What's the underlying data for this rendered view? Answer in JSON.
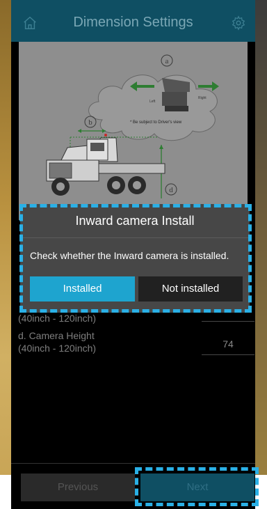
{
  "header": {
    "title": "Dimension Settings"
  },
  "diagram": {
    "marker_a": "a",
    "marker_b": "b",
    "marker_d": "d",
    "left_label": "Left",
    "right_label": "Right",
    "note": "* Be subject to Driver's view"
  },
  "fields": [
    {
      "label_line1": "(40inch - 120inch)",
      "value": ""
    },
    {
      "label_line1": "d. Camera Height",
      "label_line2": "(40inch - 120inch)",
      "value": "74"
    }
  ],
  "dialog": {
    "title": "Inward camera Install",
    "message": "Check whether the Inward camera is installed.",
    "installed_label": "Installed",
    "not_installed_label": "Not installed"
  },
  "footer": {
    "previous_label": "Previous",
    "next_label": "Next"
  }
}
